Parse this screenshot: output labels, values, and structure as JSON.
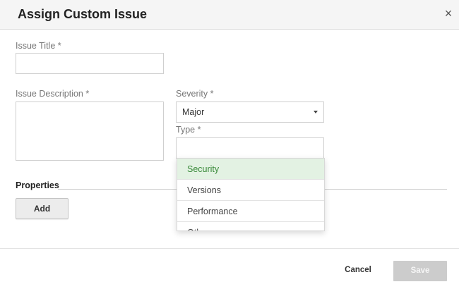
{
  "dialog": {
    "title": "Assign Custom Issue",
    "close_icon": "close-icon"
  },
  "form": {
    "issue_title": {
      "label": "Issue Title *",
      "value": ""
    },
    "issue_description": {
      "label": "Issue Description *",
      "value": ""
    },
    "severity": {
      "label": "Severity *",
      "selected": "Major",
      "icon": "chevron-down-icon"
    },
    "type": {
      "label": "Type *",
      "value": "",
      "options": [
        "Security",
        "Versions",
        "Performance",
        "Other"
      ],
      "highlighted": "Security"
    }
  },
  "properties": {
    "label": "Properties",
    "add_label": "Add"
  },
  "footer": {
    "cancel_label": "Cancel",
    "save_label": "Save",
    "save_enabled": false
  },
  "colors": {
    "header_bg": "#f5f5f5",
    "highlight_bg": "#e3f2e3",
    "highlight_text": "#3a8a3a",
    "disabled_button": "#cccccc"
  }
}
